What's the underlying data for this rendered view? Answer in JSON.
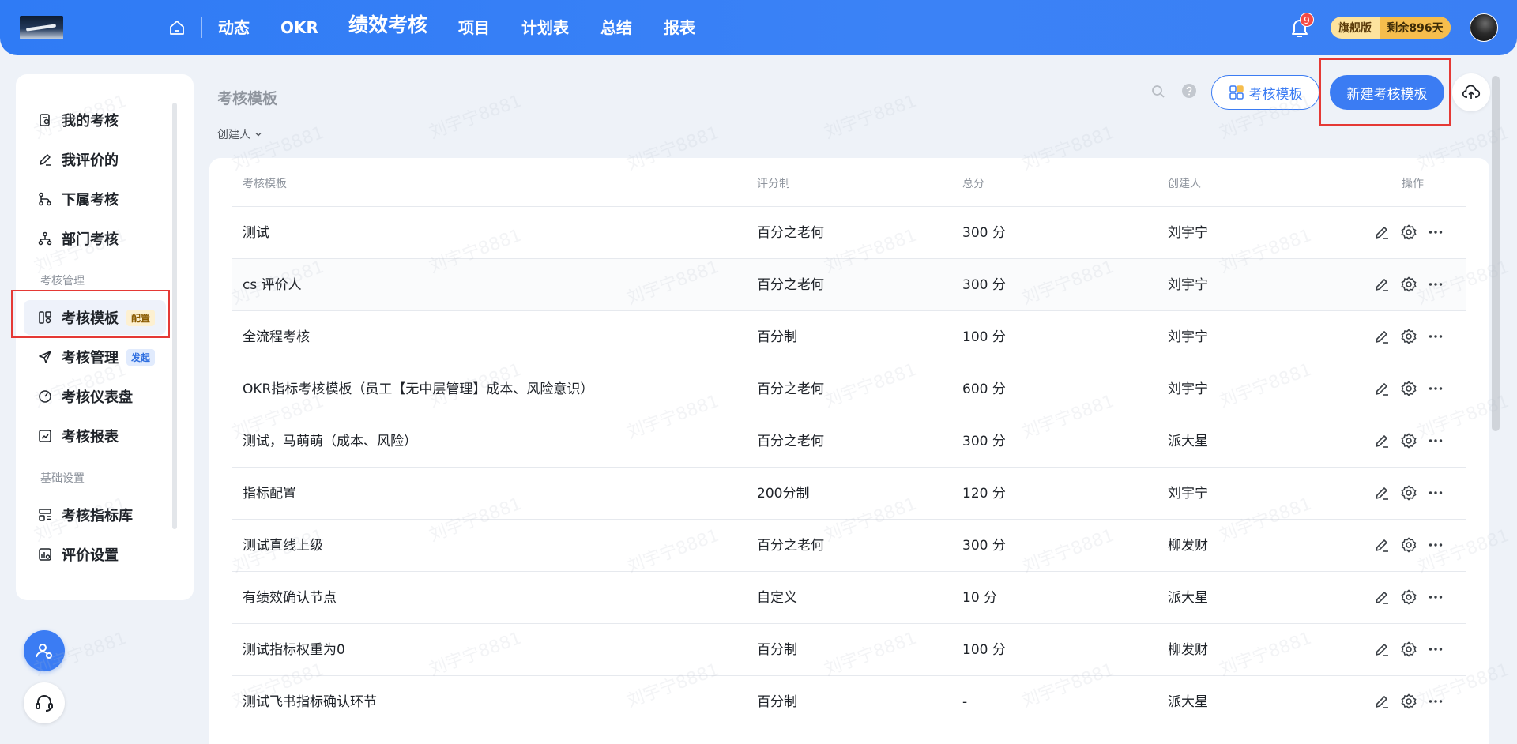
{
  "topnav": {
    "items": [
      "动态",
      "OKR",
      "绩效考核",
      "项目",
      "计划表",
      "总结",
      "报表"
    ],
    "active_index": 2,
    "notification_count": "9",
    "edition_label": "旗舰版",
    "remaining_label": "剩余896天"
  },
  "sidebar": {
    "items": [
      {
        "label": "我的考核",
        "icon": "clipboard-icon"
      },
      {
        "label": "我评价的",
        "icon": "pen-icon"
      },
      {
        "label": "下属考核",
        "icon": "branch-icon"
      },
      {
        "label": "部门考核",
        "icon": "org-icon"
      }
    ],
    "section_manage": "考核管理",
    "manage_items": [
      {
        "label": "考核模板",
        "icon": "template-icon",
        "tag": "配置"
      },
      {
        "label": "考核管理",
        "icon": "send-icon",
        "tag": "发起"
      },
      {
        "label": "考核仪表盘",
        "icon": "dashboard-icon"
      },
      {
        "label": "考核报表",
        "icon": "report-icon"
      }
    ],
    "section_basic": "基础设置",
    "basic_items": [
      {
        "label": "考核指标库",
        "icon": "indicator-icon"
      },
      {
        "label": "评价设置",
        "icon": "settings-chart-icon"
      }
    ]
  },
  "main": {
    "title": "考核模板",
    "creator_filter": "创建人",
    "template_button": "考核模板",
    "new_button": "新建考核模板",
    "columns": [
      "考核模板",
      "评分制",
      "总分",
      "创建人",
      "操作"
    ],
    "rows": [
      {
        "name": "测试",
        "scoring": "百分之老何",
        "total": "300 分",
        "creator": "刘宇宁"
      },
      {
        "name": "cs 评价人",
        "scoring": "百分之老何",
        "total": "300 分",
        "creator": "刘宇宁"
      },
      {
        "name": "全流程考核",
        "scoring": "百分制",
        "total": "100 分",
        "creator": "刘宇宁"
      },
      {
        "name": "OKR指标考核模板（员工【无中层管理】成本、风险意识）",
        "scoring": "百分之老何",
        "total": "600 分",
        "creator": "刘宇宁"
      },
      {
        "name": "测试，马萌萌（成本、风险）",
        "scoring": "百分之老何",
        "total": "300 分",
        "creator": "派大星"
      },
      {
        "name": "指标配置",
        "scoring": "200分制",
        "total": "120 分",
        "creator": "刘宇宁"
      },
      {
        "name": "测试直线上级",
        "scoring": "百分之老何",
        "total": "300 分",
        "creator": "柳发财"
      },
      {
        "name": "有绩效确认节点",
        "scoring": "自定义",
        "total": "10 分",
        "creator": "派大星"
      },
      {
        "name": "测试指标权重为0",
        "scoring": "百分制",
        "total": "100 分",
        "creator": "柳发财"
      },
      {
        "name": "测试飞书指标确认环节",
        "scoring": "百分制",
        "total": "-",
        "creator": "派大星"
      }
    ]
  },
  "watermark_text": "刘宇宁8881",
  "colors": {
    "primary": "#3b7cf3",
    "highlight": "#e53935",
    "badge": "#f54a45"
  }
}
